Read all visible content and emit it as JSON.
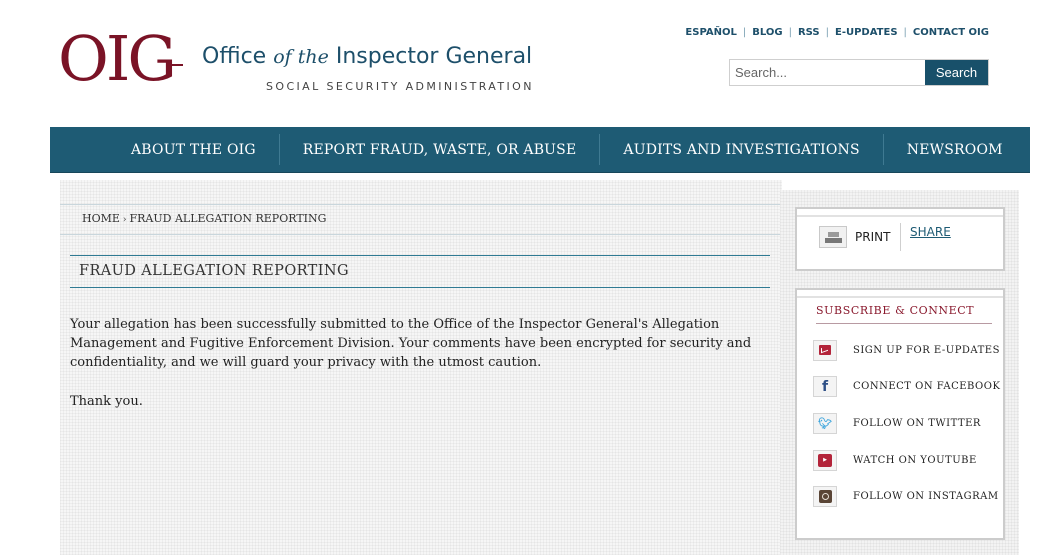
{
  "header": {
    "logo_mark": "OIG",
    "title_part1": "Office ",
    "title_italic": "of the",
    "title_part2": " Inspector General",
    "subtitle": "SOCIAL SECURITY ADMINISTRATION",
    "utility_links": [
      "ESPAÑOL",
      "BLOG",
      "RSS",
      "E-UPDATES",
      "CONTACT OIG"
    ],
    "search_placeholder": "Search...",
    "search_button": "Search"
  },
  "nav": {
    "items": [
      "ABOUT THE OIG",
      "REPORT FRAUD, WASTE, OR ABUSE",
      "AUDITS AND INVESTIGATIONS",
      "NEWSROOM"
    ]
  },
  "breadcrumb": {
    "home": "HOME",
    "separator": "›",
    "current": "FRAUD ALLEGATION REPORTING"
  },
  "main": {
    "page_title": "FRAUD ALLEGATION REPORTING",
    "paragraph1": "Your allegation has been successfully submitted to the Office of the Inspector General's Allegation Management and Fugitive Enforcement Division.  Your comments have been encrypted for security and confidentiality, and we will guard your privacy with the utmost caution.",
    "paragraph2": "Thank you."
  },
  "sidebar": {
    "print_label": "PRINT",
    "share_label": "SHARE",
    "subscribe_title": "SUBSCRIBE & CONNECT",
    "links": [
      {
        "label": "SIGN UP FOR E-UPDATES",
        "icon": "email-icon"
      },
      {
        "label": "CONNECT ON FACEBOOK",
        "icon": "facebook-icon"
      },
      {
        "label": "FOLLOW ON TWITTER",
        "icon": "twitter-icon"
      },
      {
        "label": "WATCH ON YOUTUBE",
        "icon": "youtube-icon"
      },
      {
        "label": "FOLLOW ON INSTAGRAM",
        "icon": "instagram-icon"
      }
    ]
  },
  "colors": {
    "brand_maroon": "#7a1326",
    "nav_teal": "#1e5b74",
    "link_blue": "#1d4f6a"
  }
}
